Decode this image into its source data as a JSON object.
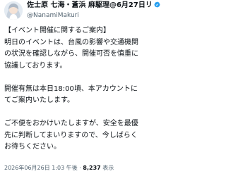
{
  "post": {
    "author": {
      "display_name": "佐士原 七海・蒼浜 麻駆理@6月27日リ",
      "handle": "@NanamiMakuri"
    },
    "lines": [
      "【イベント開催に関するご案内】",
      "明日のイベントは、台風の影響や交通機関",
      "の状況を確認しながら、開催可否を慎重に",
      "協議しております。",
      "",
      "開催有無は本日18:00頃、本アカウントに",
      "てご案内いたします。",
      "",
      "ご不便をおかけいたしますが、安全を最優",
      "先に判断してまいりますので、今しばらく",
      "お待ちください。"
    ],
    "meta": {
      "date": "2026年06月26日 1:03 午後",
      "separator": "·",
      "views_count": "8,237",
      "views_label": "表示"
    }
  },
  "colors": {
    "text": "#0f1419",
    "secondary": "#536471",
    "verified": "#1d9bf0"
  }
}
